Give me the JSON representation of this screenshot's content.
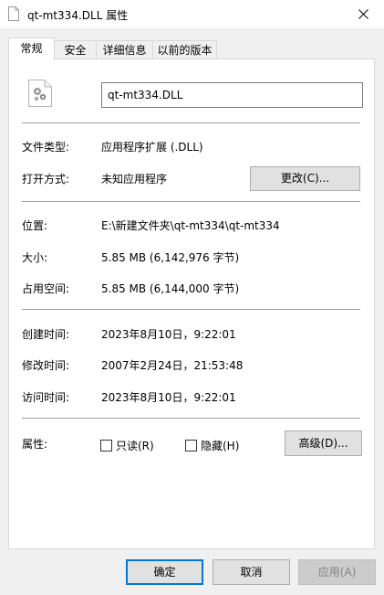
{
  "window": {
    "title": "qt-mt334.DLL 属性"
  },
  "tabs": [
    {
      "label": "常规",
      "active": true
    },
    {
      "label": "安全",
      "active": false
    },
    {
      "label": "详细信息",
      "active": false
    },
    {
      "label": "以前的版本",
      "active": false
    }
  ],
  "general": {
    "file_name": "qt-mt334.DLL",
    "file_type_label": "文件类型:",
    "file_type_value": "应用程序扩展 (.DLL)",
    "opens_with_label": "打开方式:",
    "opens_with_value": "未知应用程序",
    "change_button": "更改(C)...",
    "location_label": "位置:",
    "location_value": "E:\\新建文件夹\\qt-mt334\\qt-mt334",
    "size_label": "大小:",
    "size_value": "5.85 MB (6,142,976 字节)",
    "size_on_disk_label": "占用空间:",
    "size_on_disk_value": "5.85 MB (6,144,000 字节)",
    "created_label": "创建时间:",
    "created_value": "2023年8月10日，9:22:01",
    "modified_label": "修改时间:",
    "modified_value": "2007年2月24日，21:53:48",
    "accessed_label": "访问时间:",
    "accessed_value": "2023年8月10日，9:22:01",
    "attributes_label": "属性:",
    "readonly_label": "只读(R)",
    "readonly_checked": false,
    "hidden_label": "隐藏(H)",
    "hidden_checked": false,
    "advanced_button": "高级(D)..."
  },
  "footer": {
    "ok": "确定",
    "cancel": "取消",
    "apply": "应用(A)"
  },
  "icons": {
    "title": "file-icon",
    "close": "close-icon",
    "file": "dll-file-gear-icon"
  },
  "colors": {
    "focus_border": "#0078d7",
    "button_bg": "#e1e1e1",
    "window_bg": "#f0f0f0"
  }
}
